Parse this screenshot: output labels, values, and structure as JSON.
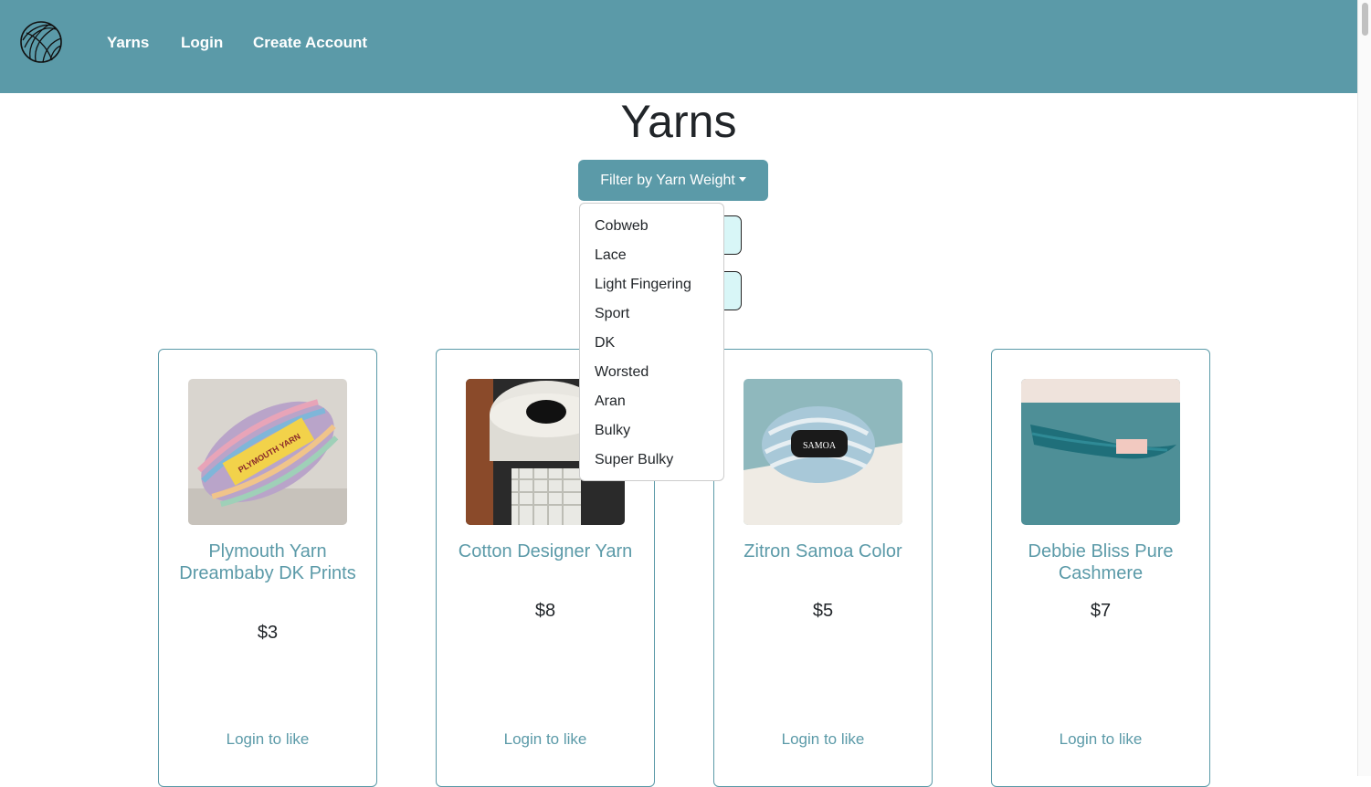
{
  "nav": {
    "logo_icon": "yarn-ball-icon",
    "links": [
      "Yarns",
      "Login",
      "Create Account"
    ]
  },
  "page": {
    "title": "Yarns"
  },
  "filter": {
    "button_label": "Filter by Yarn Weight",
    "options": [
      "Cobweb",
      "Lace",
      "Light Fingering",
      "Sport",
      "DK",
      "Worsted",
      "Aran",
      "Bulky",
      "Super Bulky"
    ]
  },
  "cards": [
    {
      "title": "Plymouth Yarn Dreambaby DK Prints",
      "price": "$3",
      "like_label": "Login to like",
      "image_label": "PLYMOUTH YARN"
    },
    {
      "title": "Cotton Designer Yarn",
      "price": "$8",
      "like_label": "Login to like"
    },
    {
      "title": "Zitron Samoa Color",
      "price": "$5",
      "like_label": "Login to like",
      "image_label": "SAMOA"
    },
    {
      "title": "Debbie Bliss Pure Cashmere",
      "price": "$7",
      "like_label": "Login to like"
    }
  ],
  "colors": {
    "brand": "#5b9aa8",
    "accent_light": "#d8f6f7"
  }
}
